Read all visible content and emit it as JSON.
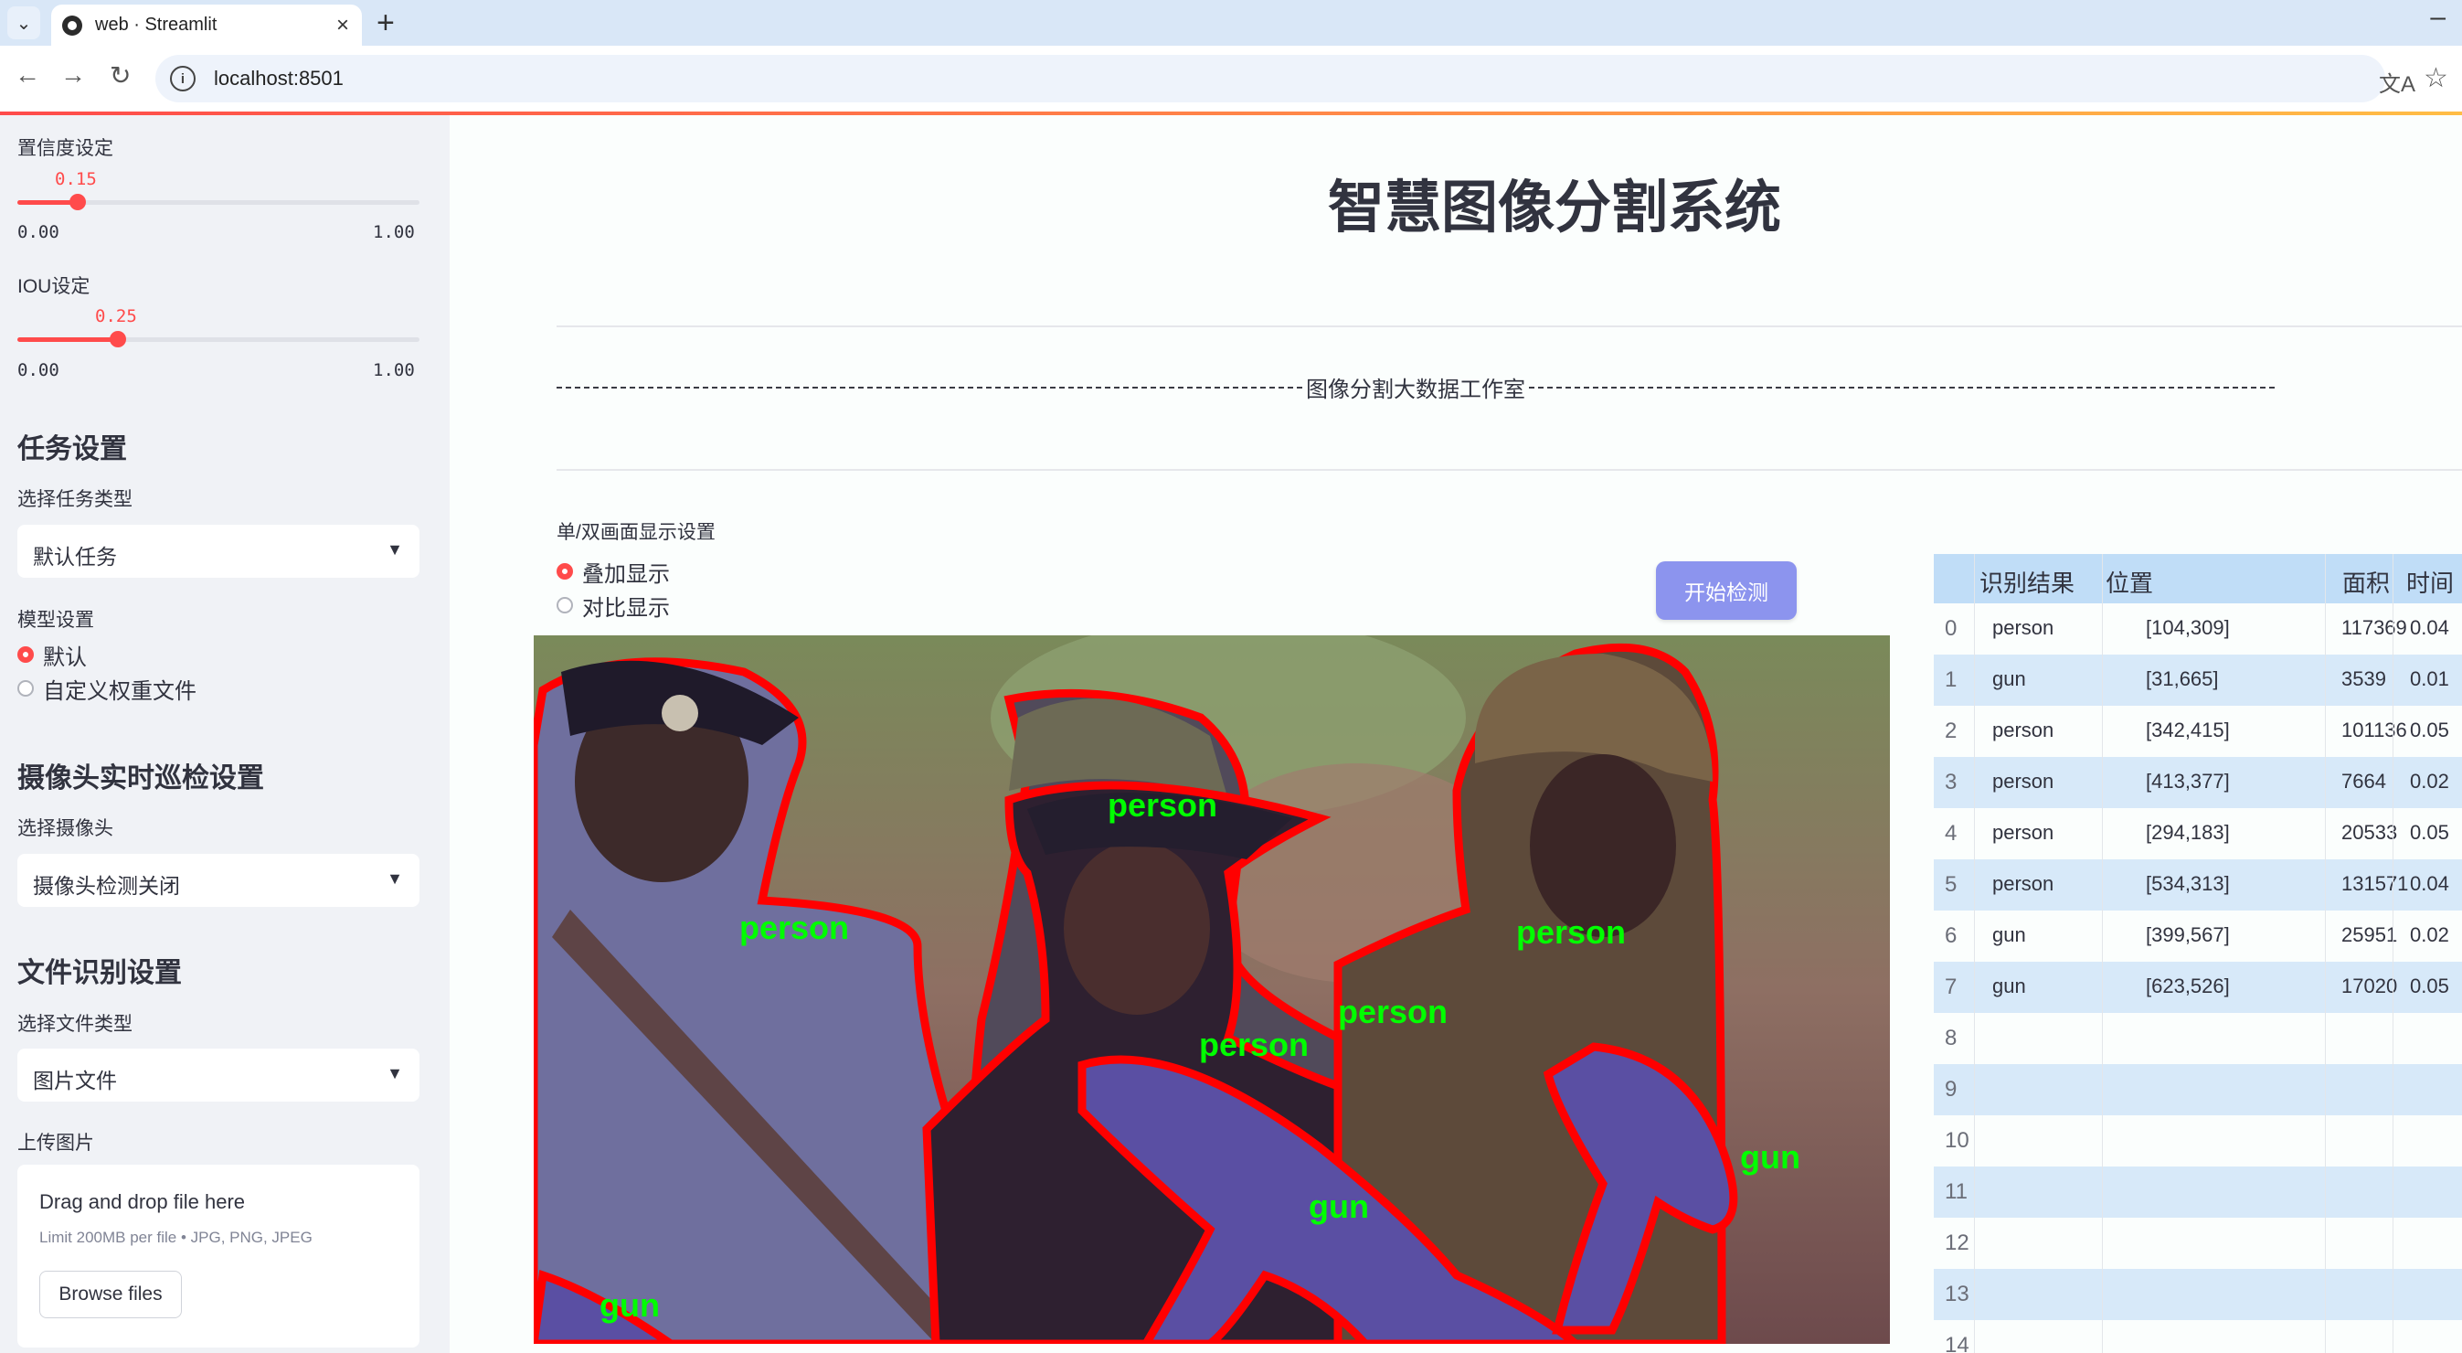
{
  "browser": {
    "tab_title": "web · Streamlit",
    "url": "localhost:8501"
  },
  "sidebar": {
    "confidence": {
      "label": "置信度设定",
      "value": "0.15",
      "min": "0.00",
      "max": "1.00",
      "fraction": 0.15
    },
    "iou": {
      "label": "IOU设定",
      "value": "0.25",
      "min": "0.00",
      "max": "1.00",
      "fraction": 0.25
    },
    "task_header": "任务设置",
    "task_type_label": "选择任务类型",
    "task_type_value": "默认任务",
    "model_label": "模型设置",
    "model_options": [
      "默认",
      "自定义权重文件"
    ],
    "model_selected": 0,
    "camera_header": "摄像头实时巡检设置",
    "camera_label": "选择摄像头",
    "camera_value": "摄像头检测关闭",
    "file_header": "文件识别设置",
    "file_type_label": "选择文件类型",
    "file_type_value": "图片文件",
    "upload_label": "上传图片",
    "upload_main": "Drag and drop file here",
    "upload_sub": "Limit 200MB per file • JPG, PNG, JPEG",
    "browse_label": "Browse files"
  },
  "main": {
    "title": "智慧图像分割系统",
    "divider_text": "图像分割大数据工作室",
    "display_mode_label": "单/双画面显示设置",
    "display_options": [
      "叠加显示",
      "对比显示"
    ],
    "display_selected": 0,
    "start_button": "开始检测",
    "image_labels": [
      "person",
      "person",
      "person",
      "person",
      "person",
      "gun",
      "gun",
      "gun"
    ]
  },
  "table": {
    "headers": [
      "识别结果",
      "位置",
      "面积",
      "时间"
    ],
    "rows": [
      {
        "idx": "0",
        "result": "person",
        "position": "[104,309]",
        "area": "117369",
        "time": "0.04"
      },
      {
        "idx": "1",
        "result": "gun",
        "position": "[31,665]",
        "area": "3539",
        "time": "0.01"
      },
      {
        "idx": "2",
        "result": "person",
        "position": "[342,415]",
        "area": "101136",
        "time": "0.05"
      },
      {
        "idx": "3",
        "result": "person",
        "position": "[413,377]",
        "area": "7664",
        "time": "0.02"
      },
      {
        "idx": "4",
        "result": "person",
        "position": "[294,183]",
        "area": "20533",
        "time": "0.05"
      },
      {
        "idx": "5",
        "result": "person",
        "position": "[534,313]",
        "area": "131571",
        "time": "0.04"
      },
      {
        "idx": "6",
        "result": "gun",
        "position": "[399,567]",
        "area": "25951",
        "time": "0.02"
      },
      {
        "idx": "7",
        "result": "gun",
        "position": "[623,526]",
        "area": "17020",
        "time": "0.05"
      },
      {
        "idx": "8",
        "result": "",
        "position": "",
        "area": "",
        "time": ""
      },
      {
        "idx": "9",
        "result": "",
        "position": "",
        "area": "",
        "time": ""
      },
      {
        "idx": "10",
        "result": "",
        "position": "",
        "area": "",
        "time": ""
      },
      {
        "idx": "11",
        "result": "",
        "position": "",
        "area": "",
        "time": ""
      },
      {
        "idx": "12",
        "result": "",
        "position": "",
        "area": "",
        "time": ""
      },
      {
        "idx": "13",
        "result": "",
        "position": "",
        "area": "",
        "time": ""
      },
      {
        "idx": "14",
        "result": "",
        "position": "",
        "area": "",
        "time": ""
      }
    ]
  },
  "colors": {
    "accent": "#ff4b4b",
    "button": "#8c94ee",
    "mask_outline": "#ff0000",
    "label_green": "#00ff00"
  }
}
